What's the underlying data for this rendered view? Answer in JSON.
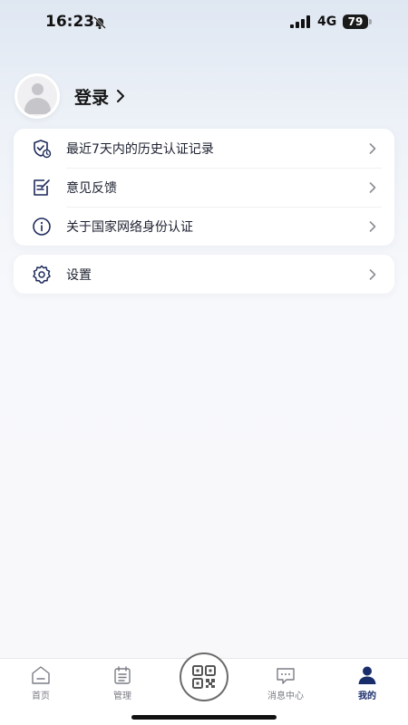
{
  "status_bar": {
    "time": "16:23",
    "network": "4G",
    "battery": "79",
    "icons": [
      "bell-off-icon",
      "signal-icon",
      "battery-icon"
    ]
  },
  "profile": {
    "login_label": "登录",
    "avatar_icon": "user-avatar-icon",
    "chevron_icon": "chevron-right-icon"
  },
  "menu": {
    "group1": [
      {
        "label": "最近7天内的历史认证记录",
        "icon": "shield-history-icon"
      },
      {
        "label": "意见反馈",
        "icon": "edit-feedback-icon"
      },
      {
        "label": "关于国家网络身份认证",
        "icon": "info-icon"
      }
    ],
    "group2": [
      {
        "label": "设置",
        "icon": "gear-icon"
      }
    ]
  },
  "tabbar": {
    "tabs": [
      {
        "label": "首页",
        "icon": "home-icon",
        "active": false
      },
      {
        "label": "管理",
        "icon": "calendar-list-icon",
        "active": false
      },
      {
        "label": "",
        "icon": "qr-scan-icon",
        "active": false
      },
      {
        "label": "消息中心",
        "icon": "message-icon",
        "active": false
      },
      {
        "label": "我的",
        "icon": "person-icon",
        "active": true
      }
    ]
  },
  "colors": {
    "accent": "#1a2d6b",
    "icon": "#1d2a5a",
    "tab_inactive": "#7a7d85",
    "chevron": "#8a8d95"
  }
}
